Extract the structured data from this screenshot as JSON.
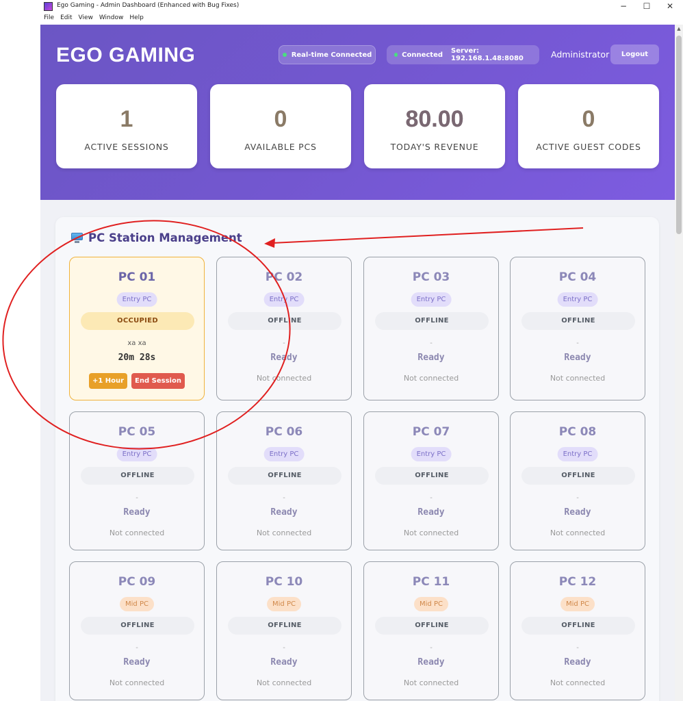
{
  "window": {
    "title": "Ego Gaming - Admin Dashboard (Enhanced with Bug Fixes)",
    "menu": [
      "File",
      "Edit",
      "View",
      "Window",
      "Help"
    ],
    "controls": {
      "minimize": "−",
      "maximize": "☐",
      "close": "✕"
    }
  },
  "header": {
    "brand": "EGO GAMING",
    "realtime_label": "Real-time Connected",
    "connection_label": "Connected",
    "server_label": "Server: 192.168.1.48:8080",
    "user": "Administrator",
    "logout_label": "Logout"
  },
  "stats": [
    {
      "value": "1",
      "label": "ACTIVE SESSIONS"
    },
    {
      "value": "0",
      "label": "AVAILABLE PCS"
    },
    {
      "value": "80.00",
      "label": "TODAY'S REVENUE"
    },
    {
      "value": "0",
      "label": "ACTIVE GUEST CODES"
    }
  ],
  "section": {
    "title": "PC Station Management",
    "icon": "desktop-computer-icon"
  },
  "pcs": [
    {
      "name": "PC 01",
      "type": "Entry PC",
      "status": "OCCUPIED",
      "user": "xa xa",
      "timer": "20m 28s",
      "add_hour_label": "+1 Hour",
      "end_session_label": "End Session"
    },
    {
      "name": "PC 02",
      "type": "Entry PC",
      "status": "OFFLINE",
      "user": "-",
      "timer": "Ready",
      "connection": "Not connected"
    },
    {
      "name": "PC 03",
      "type": "Entry PC",
      "status": "OFFLINE",
      "user": "-",
      "timer": "Ready",
      "connection": "Not connected"
    },
    {
      "name": "PC 04",
      "type": "Entry PC",
      "status": "OFFLINE",
      "user": "-",
      "timer": "Ready",
      "connection": "Not connected"
    },
    {
      "name": "PC 05",
      "type": "Entry PC",
      "status": "OFFLINE",
      "user": "-",
      "timer": "Ready",
      "connection": "Not connected"
    },
    {
      "name": "PC 06",
      "type": "Entry PC",
      "status": "OFFLINE",
      "user": "-",
      "timer": "Ready",
      "connection": "Not connected"
    },
    {
      "name": "PC 07",
      "type": "Entry PC",
      "status": "OFFLINE",
      "user": "-",
      "timer": "Ready",
      "connection": "Not connected"
    },
    {
      "name": "PC 08",
      "type": "Entry PC",
      "status": "OFFLINE",
      "user": "-",
      "timer": "Ready",
      "connection": "Not connected"
    },
    {
      "name": "PC 09",
      "type": "Mid PC",
      "status": "OFFLINE",
      "user": "-",
      "timer": "Ready",
      "connection": "Not connected"
    },
    {
      "name": "PC 10",
      "type": "Mid PC",
      "status": "OFFLINE",
      "user": "-",
      "timer": "Ready",
      "connection": "Not connected"
    },
    {
      "name": "PC 11",
      "type": "Mid PC",
      "status": "OFFLINE",
      "user": "-",
      "timer": "Ready",
      "connection": "Not connected"
    },
    {
      "name": "PC 12",
      "type": "Mid PC",
      "status": "OFFLINE",
      "user": "-",
      "timer": "Ready",
      "connection": "Not connected"
    }
  ],
  "colors": {
    "header_gradient_start": "#6b56c4",
    "header_gradient_end": "#7d5ce0",
    "connected_dot": "#4ade80",
    "occupied_border": "#f0b23a",
    "add_hour_button": "#e8a028",
    "end_session_button": "#e05a4e",
    "annotation_red": "#e02020"
  }
}
